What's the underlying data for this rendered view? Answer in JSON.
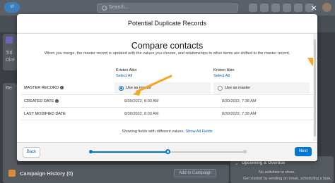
{
  "app": {
    "search_placeholder": "Search..."
  },
  "background": {
    "tab_partial": "Re",
    "left_partial_1": "Titl",
    "left_partial_2": "Dire",
    "campaign_history": "Campaign History (0)",
    "add_to_campaign": "Add to Campaign",
    "upcoming_overdue": "Upcoming & Overdue",
    "no_activities": "No activities to show.",
    "get_started": "Get started by sending an email, scheduling a task,"
  },
  "modal": {
    "title": "Potential Duplicate Records",
    "heading": "Compare contacts",
    "description": "When you merge, the master record is updated with the values you choose, and relationships to other items are shifted to the master record.",
    "records": [
      {
        "name": "Kristen Akin",
        "select_all": "Select All"
      },
      {
        "name": "Kristen Akin",
        "select_all": "Select All"
      }
    ],
    "rows": {
      "master_record": {
        "label": "MASTER RECORD",
        "option_1": "Use as master",
        "option_2": "Use as master",
        "selected": 1
      },
      "created_date": {
        "label": "CREATED DATE",
        "value_1": "8/30/2022, 8:03 AM",
        "value_2": "8/30/2022, 7:38 AM"
      },
      "last_modified": {
        "label": "LAST MODIFIED DATE",
        "value_1": "8/30/2022, 8:03 AM",
        "value_2": "8/30/2022, 7:38 AM"
      }
    },
    "fields_note": "Showing fields with different values.",
    "show_all_fields": "Show All Fields",
    "back_label": "Back",
    "next_label": "Next",
    "progress": {
      "steps": 3,
      "current_step": 2
    }
  },
  "colors": {
    "brand_blue": "#0176d3",
    "link_blue": "#0b5cab",
    "annotation_orange": "#f5a623"
  }
}
